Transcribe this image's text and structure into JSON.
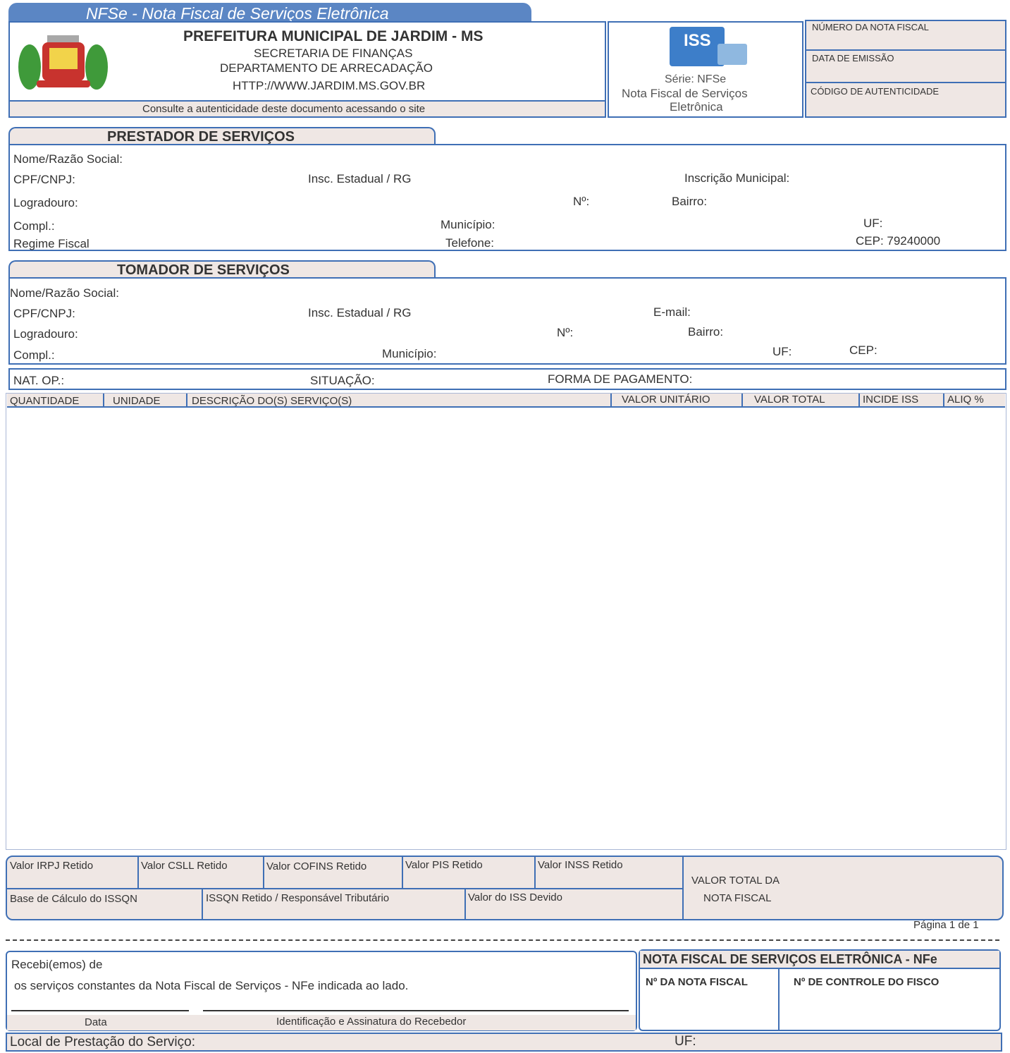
{
  "header": {
    "banner": "NFSe - Nota Fiscal de Serviços Eletrônica",
    "municipality": "PREFEITURA MUNICIPAL DE JARDIM - MS",
    "secretariat": "SECRETARIA DE FINANÇAS",
    "department": "DEPARTAMENTO DE ARRECADAÇÃO",
    "website": "HTTP://WWW.JARDIM.MS.GOV.BR",
    "consult_note": "Consulte a autenticidade deste documento acessando o site",
    "iss_logo_text": "ISS",
    "serie": "Série: NFSe",
    "serie_desc_1": "Nota Fiscal de Serviços",
    "serie_desc_2": "Eletrônica",
    "numero_nota": "NÚMERO DA NOTA FISCAL",
    "data_emissao": "DATA DE EMISSÃO",
    "codigo_autenticidade": "CÓDIGO DE AUTENTICIDADE"
  },
  "prestador": {
    "title": "PRESTADOR DE SERVIÇOS",
    "nome": "Nome/Razão Social:",
    "cpf": "CPF/CNPJ:",
    "insc_estadual": "Insc. Estadual / RG",
    "insc_municipal": "Inscrição Municipal:",
    "logradouro": "Logradouro:",
    "numero": "Nº:",
    "bairro": "Bairro:",
    "compl": "Compl.:",
    "municipio": "Município:",
    "uf": "UF:",
    "regime": "Regime Fiscal",
    "telefone": "Telefone:",
    "cep": "CEP: 79240000"
  },
  "tomador": {
    "title": "TOMADOR DE SERVIÇOS",
    "nome": "Nome/Razão Social:",
    "cpf": "CPF/CNPJ:",
    "insc_estadual": "Insc. Estadual / RG",
    "email": "E-mail:",
    "logradouro": "Logradouro:",
    "numero": "Nº:",
    "bairro": "Bairro:",
    "compl": "Compl.:",
    "municipio": "Município:",
    "uf": "UF:",
    "cep": "CEP:"
  },
  "operacao": {
    "nat_op": "NAT. OP.:",
    "situacao": "SITUAÇÃO:",
    "forma_pagamento": "FORMA DE PAGAMENTO:"
  },
  "items_table": {
    "columns": [
      "QUANTIDADE",
      "UNIDADE",
      "DESCRIÇÃO DO(S) SERVIÇO(S)",
      "VALOR UNITÁRIO",
      "VALOR TOTAL",
      "INCIDE ISS",
      "ALIQ %"
    ]
  },
  "totals": {
    "irpj": "Valor IRPJ Retido",
    "csll": "Valor CSLL Retido",
    "cofins": "Valor COFINS Retido",
    "pis": "Valor PIS Retido",
    "inss": "Valor INSS Retido",
    "base_calculo": "Base de Cálculo do ISSQN",
    "issqn_retido": "ISSQN Retido / Responsável Tributário",
    "iss_devido": "Valor do ISS Devido",
    "valor_total_1": "VALOR TOTAL DA",
    "valor_total_2": "NOTA FISCAL",
    "pagina": "Página 1 de 1"
  },
  "receipt": {
    "recebi": "Recebi(emos) de",
    "servicos": "os serviços constantes da Nota Fiscal de Serviços - NFe indicada ao lado.",
    "data": "Data",
    "identificacao": "Identificação e Assinatura do Recebedor",
    "nfe_title": "NOTA FISCAL DE SERVIÇOS ELETRÔNICA - NFe",
    "nr_nota": "Nº DA NOTA FISCAL",
    "nr_controle": "Nº DE CONTROLE DO FISCO",
    "local": "Local de Prestação do Serviço:",
    "uf": "UF:"
  },
  "colors": {
    "border": "#3f6fb5",
    "banner_bg": "#5b86c4",
    "shade": "#efe7e4"
  }
}
